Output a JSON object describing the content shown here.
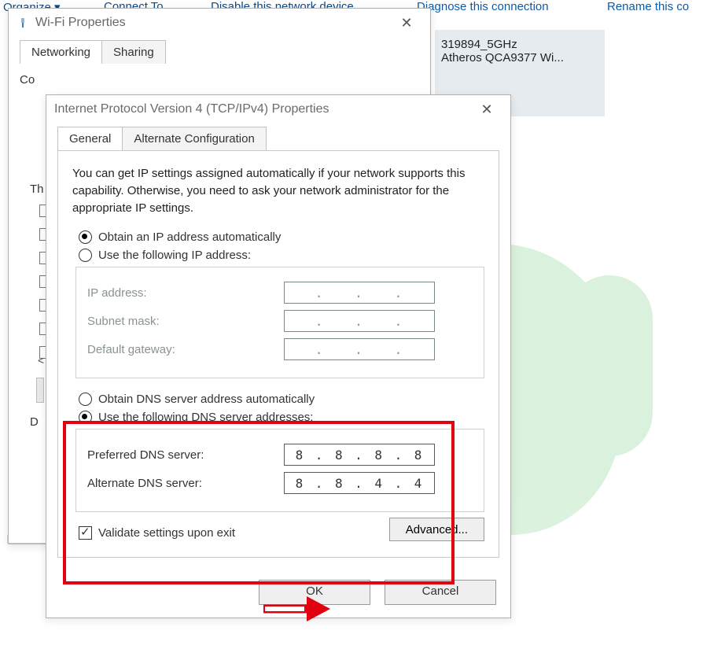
{
  "bg_toolbar": {
    "organize": "Organize ▾",
    "connect_to": "Connect To",
    "disable": "Disable this network device",
    "diagnose": "Diagnose this connection",
    "rename": "Rename this co"
  },
  "connection_tile": {
    "line1": "319894_5GHz",
    "line2": "Atheros QCA9377 Wi..."
  },
  "wifi_window": {
    "title": "Wi-Fi Properties",
    "tabs": {
      "networking": "Networking",
      "sharing": "Sharing"
    },
    "connect_using_snippet": "Co",
    "th_label": "Th",
    "d_label": "D"
  },
  "ipv4_window": {
    "title": "Internet Protocol Version 4 (TCP/IPv4) Properties",
    "tabs": {
      "general": "General",
      "alternate": "Alternate Configuration"
    },
    "description": "You can get IP settings assigned automatically if your network supports this capability. Otherwise, you need to ask your network administrator for the appropriate IP settings.",
    "ip": {
      "auto_label": "Obtain an IP address automatically",
      "manual_label": "Use the following IP address:",
      "selected": "auto",
      "fields": {
        "ip_address": {
          "label": "IP address:"
        },
        "subnet": {
          "label": "Subnet mask:"
        },
        "gateway": {
          "label": "Default gateway:"
        }
      }
    },
    "dns": {
      "auto_label": "Obtain DNS server address automatically",
      "manual_label": "Use the following DNS server addresses:",
      "selected": "manual",
      "fields": {
        "preferred": {
          "label": "Preferred DNS server:",
          "value": [
            "8",
            "8",
            "8",
            "8"
          ]
        },
        "alternate": {
          "label": "Alternate DNS server:",
          "value": [
            "8",
            "8",
            "4",
            "4"
          ]
        }
      }
    },
    "validate_label": "Validate settings upon exit",
    "validate_checked": true,
    "advanced_label": "Advanced...",
    "ok_label": "OK",
    "cancel_label": "Cancel"
  }
}
